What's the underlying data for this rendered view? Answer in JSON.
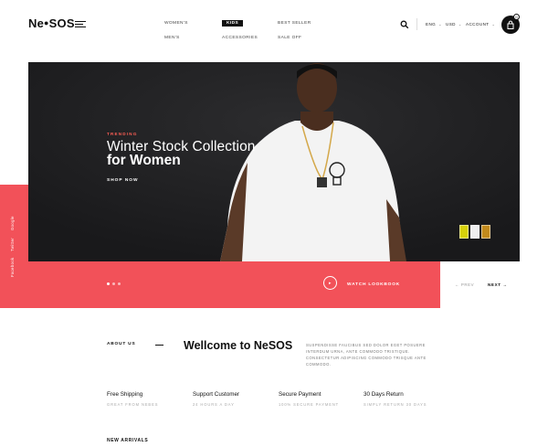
{
  "brand": {
    "logo_prefix": "Ne",
    "logo_suffix": "SOS"
  },
  "nav": {
    "women": "WOMEN'S",
    "kids": "KIDS",
    "best_seller": "BEST SELLER",
    "mens": "MEN'S",
    "accessories": "ACCESSORIES",
    "sale_off": "SALE OFF"
  },
  "header": {
    "language": "ENG",
    "currency": "USD",
    "account": "ACCOUNT",
    "cart_count": "0"
  },
  "hero": {
    "trending": "TRENDING",
    "title_line1": "Winter Stock Collection",
    "title_line2": "for Women",
    "cta": "SHOP NOW",
    "watch": "WATCH LOOKBOOK",
    "prev": "PREV",
    "next": "NEXT"
  },
  "social": [
    "Google",
    "Twitter",
    "Facebook"
  ],
  "about": {
    "label": "ABOUT US",
    "title": "Wellcome to NeSOS",
    "text": "SUSPENDISSE FAUCIBUS SED DOLOR EGET POSUERE INTERDUM URNA, ANTE COMMODO TRISTIQUE. CONSECTETUR ADIPISCING COMMODO TRISQUE ANTE COMMODO."
  },
  "features": [
    {
      "title": "Free Shipping",
      "sub": "GREAT FROM NEBES"
    },
    {
      "title": "Support Customer",
      "sub": "24 HOURS A DAY"
    },
    {
      "title": "Secure Payment",
      "sub": "100% SECURE PAYMENT"
    },
    {
      "title": "30 Days Return",
      "sub": "SIMPLY RETURN 30 DAYS"
    }
  ],
  "new_arrivals": "NEW ARRIVALS",
  "colors": {
    "accent": "#f25159",
    "dark": "#1f1f21"
  }
}
